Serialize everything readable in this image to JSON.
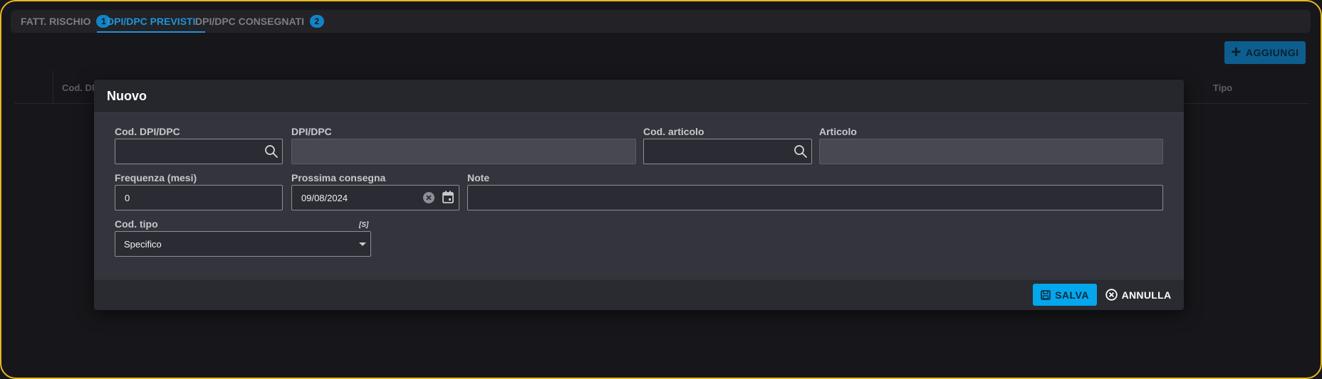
{
  "tabs": [
    {
      "label": "FATT. RISCHIO",
      "badge": "1"
    },
    {
      "label": "DPI/DPC PREVISTI"
    },
    {
      "label": "DPI/DPC CONSEGNATI",
      "badge": "2"
    }
  ],
  "toolbar": {
    "add_label": "AGGIUNGI"
  },
  "grid": {
    "columns": [
      "Cod. DP",
      "Tipo"
    ]
  },
  "modal": {
    "title": "Nuovo",
    "fields": {
      "cod_dpi": {
        "label": "Cod. DPI/DPC",
        "value": ""
      },
      "dpi": {
        "label": "DPI/DPC",
        "value": ""
      },
      "cod_articolo": {
        "label": "Cod. articolo",
        "value": ""
      },
      "articolo": {
        "label": "Articolo",
        "value": ""
      },
      "frequenza": {
        "label": "Frequenza (mesi)",
        "value": "0"
      },
      "prossima": {
        "label": "Prossima consegna",
        "value": "09/08/2024"
      },
      "note": {
        "label": "Note",
        "value": ""
      },
      "cod_tipo": {
        "label": "Cod. tipo",
        "flag": "[S]",
        "value": "Specifico"
      }
    },
    "save_label": "SALVA",
    "cancel_label": "ANNULLA"
  },
  "colors": {
    "accent": "#04a6ec",
    "frame_border": "#e8b822",
    "tab_active": "#1f94d6",
    "background": "#17171b"
  }
}
